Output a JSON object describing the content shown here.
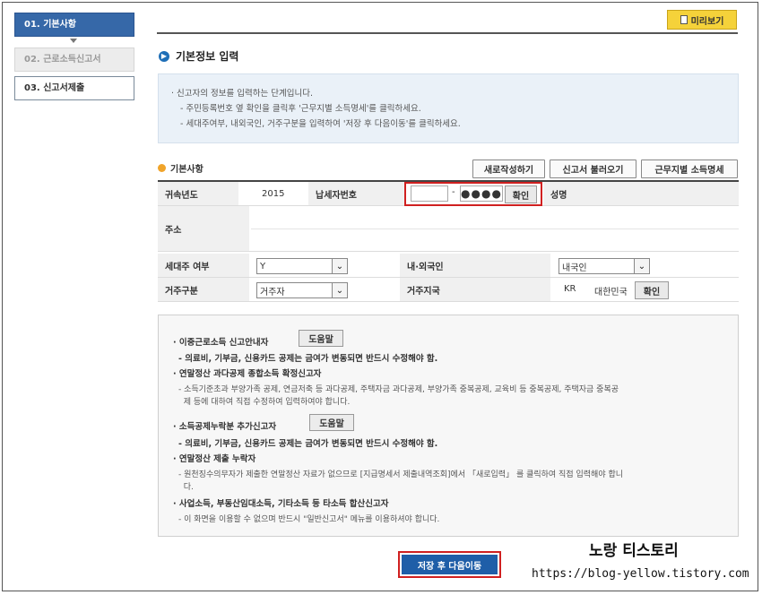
{
  "sidebar": {
    "steps": [
      {
        "label": "01. 기본사항"
      },
      {
        "label": "02. 근로소득신고서"
      },
      {
        "label": "03. 신고서제출"
      }
    ]
  },
  "toolbar": {
    "preview_label": "미리보기"
  },
  "section_title": "기본정보 입력",
  "info": {
    "line1": "· 신고자의 정보를 입력하는 단계입니다.",
    "line2": "- 주민등록번호 옆 확인을 클릭후 '근무지별 소득명세'를 클릭하세요.",
    "line3": "- 세대주여부, 내외국인, 거주구분을 입력하여 '저장 후 다음이동'를 클릭하세요."
  },
  "basic": {
    "title": "기본사항",
    "buttons": {
      "new": "새로작성하기",
      "load": "신고서 불러오기",
      "workplace": "근무지별 소득명세"
    },
    "labels": {
      "year": "귀속년도",
      "taxpayer_id": "납세자번호",
      "name": "성명",
      "address": "주소",
      "householder": "세대주 여부",
      "nationality": "내·외국인",
      "residency": "거주구분",
      "residence_country": "거주지국"
    },
    "values": {
      "year": "2015",
      "id_dash": "-",
      "id_masked": "●●●●",
      "confirm": "확인",
      "householder": "Y",
      "nationality": "내국인",
      "residency": "거주자",
      "country_code": "KR",
      "country_name": "대한민국",
      "country_confirm": "확인"
    }
  },
  "notice": {
    "help_label": "도움말",
    "items": [
      {
        "text": "· 이중근로소득 신고안내자",
        "style": "bold"
      },
      {
        "text": "- 의료비, 기부금, 신용카드 공제는 금여가 변동되면 반드시 수정해야 함.",
        "style": "bold"
      },
      {
        "text": "· 연말정산 과다공제 종합소득 확정신고자",
        "style": "bold"
      },
      {
        "text": "- 소득기준초과 부양가족 공제, 연금저축 등 과다공제, 주택자금 과다공제, 부양가족 중복공제, 교육비 등 중복공제, 주택자금 중복공",
        "style": "norm"
      },
      {
        "text": "  제 등에 대하여 직접 수정하여 입력하여야 합니다.",
        "style": "norm"
      },
      {
        "text": "· 소득공제누락분 추가신고자",
        "style": "bold"
      },
      {
        "text": "- 의료비, 기부금, 신용카드 공제는 금여가 변동되면 반드시 수정해야 함.",
        "style": "bold"
      },
      {
        "text": "· 연말정산 제출 누락자",
        "style": "bold"
      },
      {
        "text": "- 원천징수의무자가 제출한 연말정산 자료가 없으므로 [지급명세서 제출내역조회]에서 「새로입력」 를 클릭하여 직접 입력해야 합니",
        "style": "norm"
      },
      {
        "text": "  다.",
        "style": "norm"
      },
      {
        "text": "· 사업소득, 부동산임대소득, 기타소득 등 타소득 합산신고자",
        "style": "bold"
      },
      {
        "text": "- 이 화면을 이용할 수 없으며 반드시 \"일반신고서\" 메뉴를 이용하셔야 합니다.",
        "style": "norm"
      }
    ]
  },
  "save_label": "저장 후 다음이동",
  "watermark": {
    "title": "노랑 티스토리",
    "url": "https://blog-yellow.tistory.com"
  }
}
